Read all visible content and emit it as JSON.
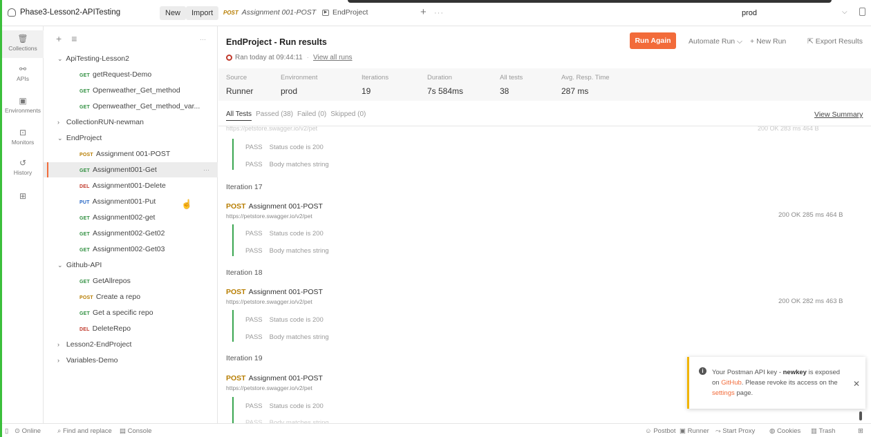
{
  "topbar": {
    "workspace": "Phase3-Lesson2-APITesting",
    "new_label": "New",
    "import_label": "Import",
    "tab1_method": "POST",
    "tab1_label": "Assignment 001-POST",
    "tab2_label": "EndProject",
    "environment": "prod"
  },
  "rail": {
    "collections": "Collections",
    "apis": "APIs",
    "environments": "Environments",
    "monitors": "Monitors",
    "history": "History"
  },
  "sidebar": {
    "rows": [
      {
        "type": "folder",
        "label": "ApiTesting-Lesson2",
        "open": true
      },
      {
        "type": "req",
        "method": "GET",
        "label": "getRequest-Demo"
      },
      {
        "type": "req",
        "method": "GET",
        "label": "Openweather_Get_method"
      },
      {
        "type": "req",
        "method": "GET",
        "label": "Openweather_Get_method_var..."
      },
      {
        "type": "folder",
        "label": "CollectionRUN-newman",
        "open": false
      },
      {
        "type": "folder",
        "label": "EndProject",
        "open": true
      },
      {
        "type": "req",
        "method": "POST",
        "label": "Assignment 001-POST"
      },
      {
        "type": "req",
        "method": "GET",
        "label": "Assignment001-Get",
        "selected": true
      },
      {
        "type": "req",
        "method": "DEL",
        "label": "Assignment001-Delete"
      },
      {
        "type": "req",
        "method": "PUT",
        "label": "Assignment001-Put"
      },
      {
        "type": "req",
        "method": "GET",
        "label": "Assignment002-get"
      },
      {
        "type": "req",
        "method": "GET",
        "label": "Assignment002-Get02"
      },
      {
        "type": "req",
        "method": "GET",
        "label": "Assignment002-Get03"
      },
      {
        "type": "folder",
        "label": "Github-API",
        "open": true
      },
      {
        "type": "req",
        "method": "GET",
        "label": "GetAllrepos"
      },
      {
        "type": "req",
        "method": "POST",
        "label": "Create a repo"
      },
      {
        "type": "req",
        "method": "GET",
        "label": "Get a specific repo"
      },
      {
        "type": "req",
        "method": "DEL",
        "label": "DeleteRepo"
      },
      {
        "type": "folder",
        "label": "Lesson2-EndProject",
        "open": false
      },
      {
        "type": "folder",
        "label": "Variables-Demo",
        "open": false
      }
    ]
  },
  "main": {
    "title": "EndProject - Run results",
    "ran_text": "Ran today at 09:44:11",
    "view_all_runs": "View all runs",
    "run_again": "Run Again",
    "automate_run": "Automate Run",
    "new_run": "New Run",
    "export_results": "Export Results",
    "summary": [
      {
        "key": "Source",
        "value": "Runner"
      },
      {
        "key": "Environment",
        "value": "prod"
      },
      {
        "key": "Iterations",
        "value": "19"
      },
      {
        "key": "Duration",
        "value": "7s 584ms"
      },
      {
        "key": "All tests",
        "value": "38"
      },
      {
        "key": "Avg. Resp. Time",
        "value": "287 ms"
      }
    ],
    "filters": {
      "all": "All Tests",
      "passed": "Passed (38)",
      "failed": "Failed (0)",
      "skipped": "Skipped (0)"
    },
    "view_summary": "View Summary",
    "partial_url": "https://petstore.swagger.io/v2/pet",
    "partial_stat": "200 OK  283 ms  464 B",
    "pass_label": "PASS",
    "test1": "Status code is 200",
    "test2": "Body matches string",
    "iterations": [
      {
        "label": "Iteration 17",
        "method": "POST",
        "name": "Assignment 001-POST",
        "url": "https://petstore.swagger.io/v2/pet",
        "status": "200 OK  285 ms  464 B"
      },
      {
        "label": "Iteration 18",
        "method": "POST",
        "name": "Assignment 001-POST",
        "url": "https://petstore.swagger.io/v2/pet",
        "status": "200 OK  282 ms  463 B"
      },
      {
        "label": "Iteration 19",
        "method": "POST",
        "name": "Assignment 001-POST",
        "url": "https://petstore.swagger.io/v2/pet",
        "status": ""
      }
    ]
  },
  "toast": {
    "line1": "Your Postman API key - ",
    "key_name": "newkey",
    "line2": " is exposed on ",
    "github": "GitHub",
    "line3": ". Please revoke its access on the ",
    "settings": "settings",
    "line4": " page."
  },
  "statusbar": {
    "online": "Online",
    "find": "Find and replace",
    "console": "Console",
    "postbot": "Postbot",
    "runner": "Runner",
    "proxy": "Start Proxy",
    "cookies": "Cookies",
    "trash": "Trash"
  },
  "colors": {
    "accent": "#f26b3a",
    "pass_bar": "#3aa650",
    "post": "#b77d00",
    "get": "#2f8f3f"
  }
}
